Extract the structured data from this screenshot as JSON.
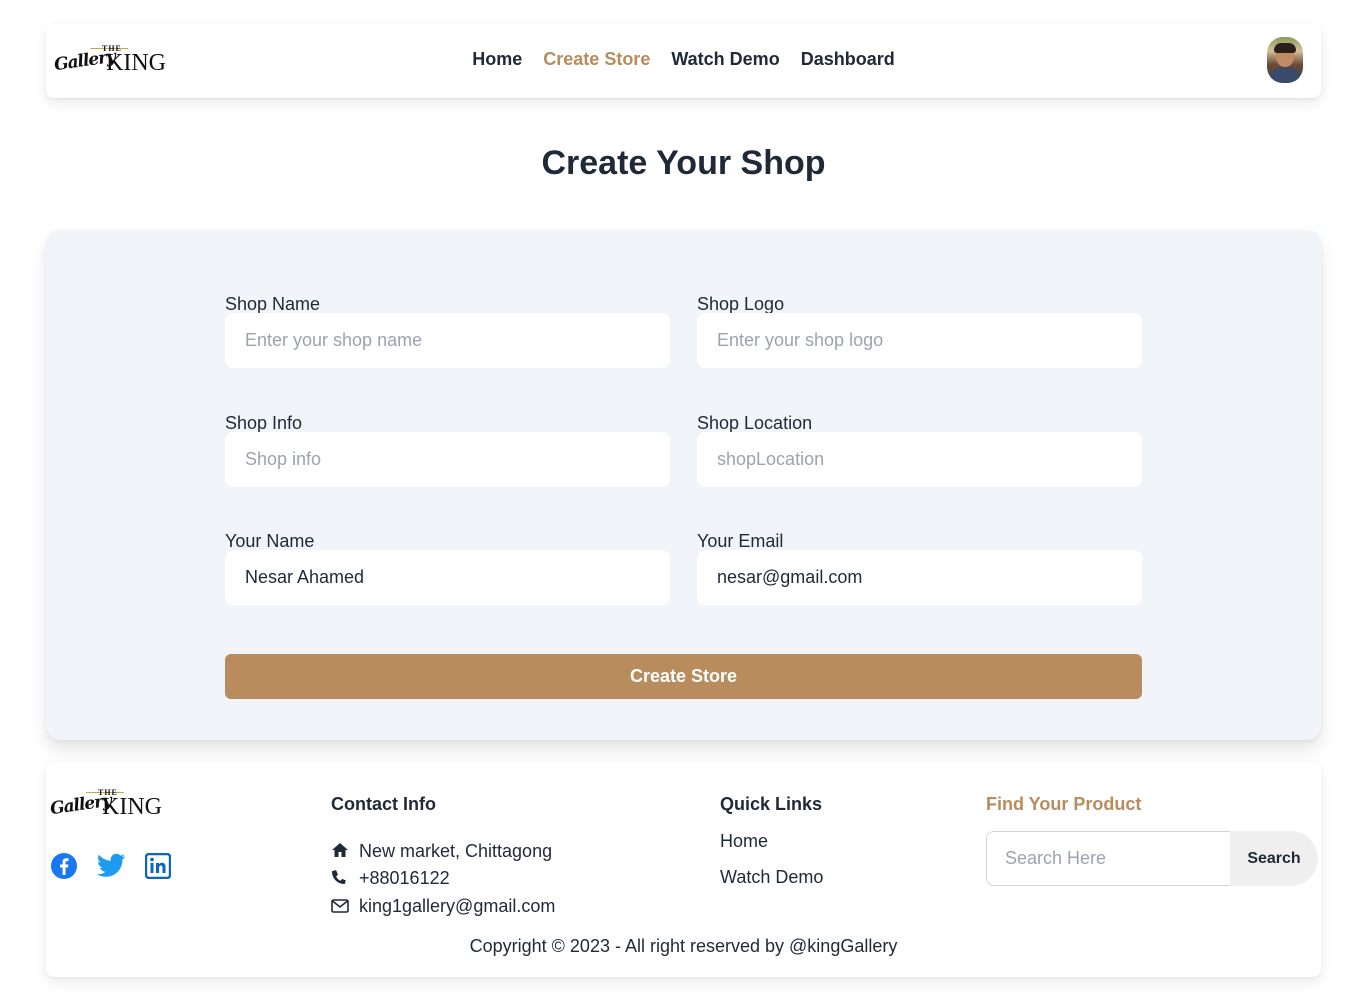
{
  "brand": {
    "the": "THE",
    "gallery": "Gallery",
    "king": "KING"
  },
  "nav": {
    "links": [
      {
        "label": "Home",
        "active": false
      },
      {
        "label": "Create Store",
        "active": true
      },
      {
        "label": "Watch Demo",
        "active": false
      },
      {
        "label": "Dashboard",
        "active": false
      }
    ]
  },
  "page": {
    "title": "Create Your Shop"
  },
  "form": {
    "shop_name": {
      "label": "Shop Name",
      "placeholder": "Enter your shop name",
      "value": ""
    },
    "shop_logo": {
      "label": "Shop Logo",
      "placeholder": "Enter your shop logo",
      "value": ""
    },
    "shop_info": {
      "label": "Shop Info",
      "placeholder": "Shop info",
      "value": ""
    },
    "shop_location": {
      "label": "Shop Location",
      "placeholder": "shopLocation",
      "value": ""
    },
    "your_name": {
      "label": "Your Name",
      "placeholder": "",
      "value": "Nesar Ahamed"
    },
    "your_email": {
      "label": "Your Email",
      "placeholder": "",
      "value": "nesar@gmail.com"
    },
    "submit_label": "Create Store"
  },
  "footer": {
    "socials": [
      "facebook-icon",
      "twitter-icon",
      "linkedin-icon"
    ],
    "contact": {
      "title": "Contact Info",
      "address": "New market, Chittagong",
      "phone": "+88016122",
      "email": "king1gallery@gmail.com"
    },
    "quick_links": {
      "title": "Quick Links",
      "items": [
        "Home",
        "Watch Demo"
      ]
    },
    "find": {
      "title": "Find Your Product",
      "placeholder": "Search Here",
      "button": "Search"
    },
    "copyright": "Copyright © 2023 - All right reserved by @kingGallery"
  },
  "colors": {
    "accent": "#b88c5c",
    "card_bg": "#f1f4f8",
    "text": "#1f2937"
  }
}
